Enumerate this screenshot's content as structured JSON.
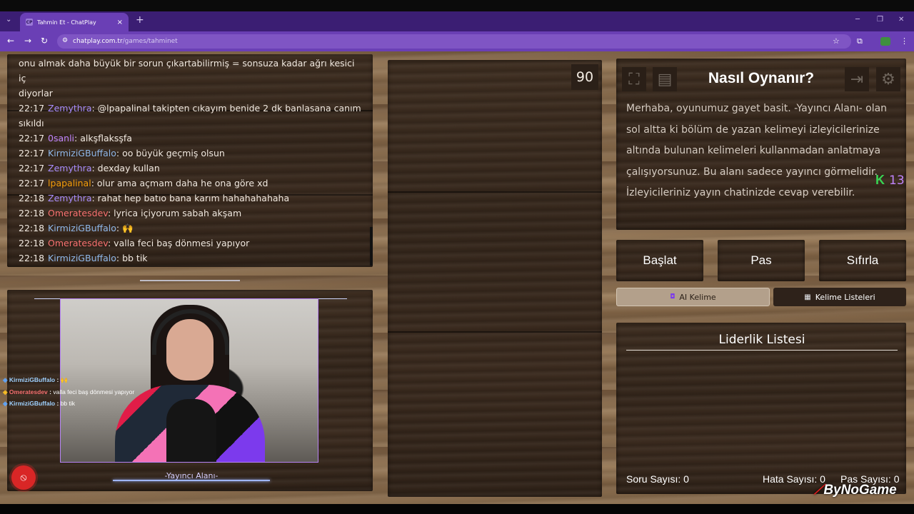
{
  "browser": {
    "tab_title": "Tahmin Et - ChatPlay",
    "tab_favicon": "CP",
    "url_host": "chatplay.com.tr",
    "url_path": "/games/tahminet"
  },
  "chat": {
    "lines": [
      {
        "time": "",
        "user": "",
        "text": "onu almak daha büyük bir sorun çıkartabilirmiş = sonsuza kadar ağrı kesici iç",
        "color": "plain"
      },
      {
        "time": "",
        "user": "",
        "text": "diyorlar",
        "color": "plain"
      },
      {
        "time": "22:17",
        "user": "Zemythra",
        "text": ": @lpapalinal takipten cıkayım benide 2 dk banlasana canım sıkıldı",
        "color": "purple"
      },
      {
        "time": "22:17",
        "user": "0sanli",
        "text": ": alkşflaksşfa",
        "color": "violet"
      },
      {
        "time": "22:17",
        "user": "KirmiziGBuffalo",
        "text": ": oo büyük geçmiş olsun",
        "color": "blue"
      },
      {
        "time": "22:17",
        "user": "Zemythra",
        "text": ": dexday kullan",
        "color": "purple"
      },
      {
        "time": "22:17",
        "user": "lpapalinal",
        "text": ": olur ama açmam daha he ona göre xd",
        "color": "orange"
      },
      {
        "time": "22:18",
        "user": "Zemythra",
        "text": ": rahat hep batıo bana karım hahahahahaha",
        "color": "purple"
      },
      {
        "time": "22:18",
        "user": "Omeratesdev",
        "text": ": lyrica içiyorum sabah akşam",
        "color": "red"
      },
      {
        "time": "22:18",
        "user": "KirmiziGBuffalo",
        "text": ": 🙌",
        "color": "blue"
      },
      {
        "time": "22:18",
        "user": "Omeratesdev",
        "text": ": valla feci baş dönmesi yapıyor",
        "color": "red"
      },
      {
        "time": "22:18",
        "user": "KirmiziGBuffalo",
        "text": ": bb tik",
        "color": "blue"
      }
    ]
  },
  "camera": {
    "label": "-Yayıncı Alanı-"
  },
  "overlay_chat": [
    {
      "user": "KirmiziGBuffalo",
      "sep": " : ",
      "msg": "🙌",
      "red": false
    },
    {
      "user": "Omeratesdev",
      "sep": " : ",
      "msg": "valla feci baş dönmesi yapıyor",
      "red": true
    },
    {
      "user": "KirmiziGBuffalo",
      "sep": " : ",
      "msg": "bb tik",
      "red": false
    }
  ],
  "timer": "90",
  "how_to": {
    "title": "Nasıl Oynanır?",
    "text": "Merhaba, oyunumuz gayet basit. -Yayıncı Alanı- olan sol altta ki bölüm de yazan kelimeyi izleyicilerinize altında bulunan kelimeleri kullanmadan anlatmaya çalışıyorsunuz. Bu alanı sadece yayıncı görmelidir. İzleyicileriniz yayın chatinizde cevap verebilir."
  },
  "buttons": {
    "start": "Başlat",
    "pass": "Pas",
    "reset": "Sıfırla"
  },
  "tabs": {
    "ai_word": "AI Kelime",
    "word_lists": "Kelime Listeleri"
  },
  "leaderboard": {
    "title": "Liderlik Listesi"
  },
  "stats": {
    "questions_label": "Soru Sayısı:",
    "questions_value": "0",
    "errors_label": "Hata Sayısı:",
    "errors_value": "0",
    "passes_label": "Pas Sayısı:",
    "passes_value": "0"
  },
  "kick_badge": {
    "letter": "K",
    "count": "13"
  },
  "brand": {
    "mark": "⟋",
    "name": "ByNoGame"
  },
  "icons": {
    "fullscreen": "fullscreen-icon",
    "notes": "notes-icon",
    "exit": "exit-icon",
    "settings": "gear-icon"
  }
}
